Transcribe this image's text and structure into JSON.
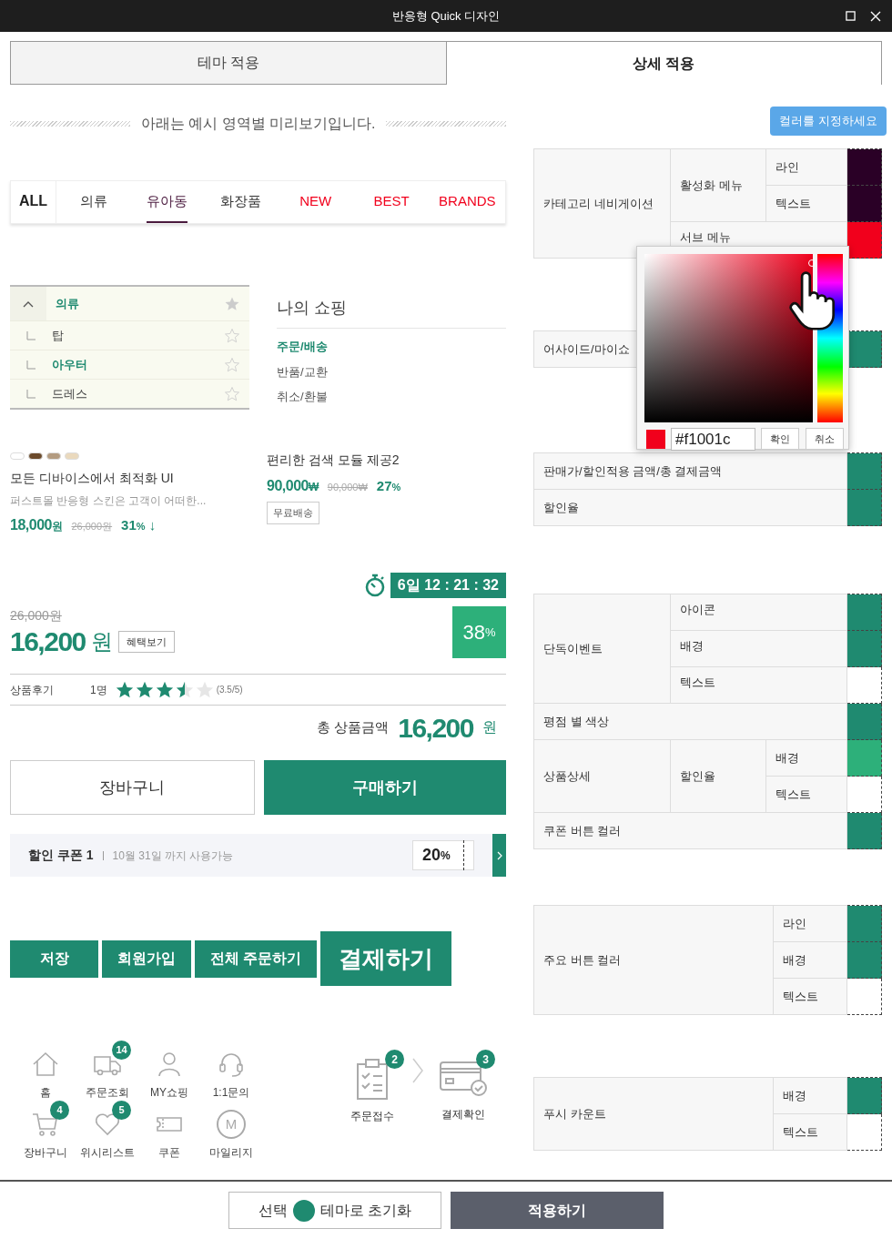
{
  "window": {
    "title": "반응형 Quick 디자인"
  },
  "tabs": [
    {
      "label": "테마 적용",
      "selected": false
    },
    {
      "label": "상세 적용",
      "selected": true
    }
  ],
  "preview": {
    "heading": "아래는 예시 영역별 미리보기입니다.",
    "category_nav": [
      {
        "label": "ALL",
        "kind": "all",
        "selected": false
      },
      {
        "label": "의류",
        "kind": "normal",
        "selected": false
      },
      {
        "label": "유아동",
        "kind": "normal",
        "selected": true
      },
      {
        "label": "화장품",
        "kind": "normal",
        "selected": false
      },
      {
        "label": "NEW",
        "kind": "accent",
        "selected": false
      },
      {
        "label": "BEST",
        "kind": "accent",
        "selected": false
      },
      {
        "label": "BRANDS",
        "kind": "accent",
        "selected": false
      }
    ],
    "side_menu": {
      "label": "의류",
      "expanded": true,
      "selected": true,
      "starred": true,
      "children": [
        {
          "label": "탑",
          "selected": false,
          "starred": false
        },
        {
          "label": "아우터",
          "selected": true,
          "starred": false
        },
        {
          "label": "드레스",
          "selected": false,
          "starred": false
        }
      ]
    },
    "my_shopping": {
      "title": "나의 쇼핑",
      "links": [
        {
          "label": "주문/배송",
          "selected": true
        },
        {
          "label": "반품/교환",
          "selected": false
        },
        {
          "label": "취소/환불",
          "selected": false
        }
      ]
    },
    "products": [
      {
        "swatches": [
          {
            "color": "#ffffff"
          },
          {
            "color": "#6b4a2b"
          },
          {
            "color": "#b39b80"
          },
          {
            "color": "#ead9bd"
          }
        ],
        "title": "모든 디바이스에서 최적화 UI",
        "description": "퍼스트몰 반응형 스킨은 고객이 어떠한...",
        "price": "18,000",
        "currency": "원",
        "old_price": "26,000원",
        "discount": "31",
        "discount_unit": "%",
        "discount_arrow": "↓"
      },
      {
        "title": "편리한 검색 모듈 제공2",
        "price": "90,000",
        "currency": "₩",
        "old_price": "90,000₩",
        "discount": "27",
        "discount_unit": "%",
        "tag": "무료배송"
      }
    ],
    "timer": {
      "day": "6일",
      "time": "12 : 21 : 32"
    },
    "deal": {
      "old_price": "26,000원",
      "price": "16,200",
      "currency": "원",
      "benefit_button": "혜택보기",
      "discount": "38",
      "discount_unit": "%"
    },
    "review": {
      "label": "상품후기",
      "count": "1명",
      "stars": 3.5,
      "score": "(3.5/5)"
    },
    "total": {
      "label": "총 상품금액",
      "amount": "16,200",
      "currency": "원"
    },
    "buy_buttons": [
      {
        "label": "장바구니",
        "kind": "outline"
      },
      {
        "label": "구매하기",
        "kind": "primary"
      }
    ],
    "coupon": {
      "title": "할인 쿠폰 1",
      "note": "10월 31일 까지 사용가능",
      "value": "20",
      "unit": "%"
    },
    "action_buttons": [
      {
        "label": "저장",
        "kind": "normal"
      },
      {
        "label": "회원가입",
        "kind": "normal"
      },
      {
        "label": "전체 주문하기",
        "kind": "normal"
      },
      {
        "label": "결제하기",
        "kind": "large"
      }
    ],
    "shortcuts": [
      {
        "label": "홈"
      },
      {
        "label": "주문조회",
        "badge": "14"
      },
      {
        "label": "MY쇼핑"
      },
      {
        "label": "1:1문의"
      },
      {
        "label": "장바구니",
        "badge": "4"
      },
      {
        "label": "위시리스트",
        "badge": "5"
      },
      {
        "label": "쿠폰"
      },
      {
        "label": "마일리지",
        "symbol": "M"
      }
    ],
    "order_steps": [
      {
        "label": "주문접수",
        "badge": "2"
      },
      {
        "label": "결제확인",
        "badge": "3"
      }
    ]
  },
  "color_tip": "컬러를 지정하세요",
  "color_groups": [
    {
      "rows": [
        {
          "label": "카테고리 네비게이션",
          "children": [
            {
              "label": "활성화 메뉴",
              "children": [
                {
                  "label": "라인",
                  "color": "#2a0026"
                },
                {
                  "label": "텍스트",
                  "color": "#2a0026"
                }
              ]
            },
            {
              "label": "서브 메뉴",
              "color": "#f1001c"
            }
          ]
        }
      ]
    },
    {
      "rows": [
        {
          "label": "어사이드/마이쇼",
          "color": "#1f8a70"
        }
      ]
    },
    {
      "rows": [
        {
          "label": "판매가/할인적용 금액/총 결제금액",
          "color": "#1f8a70"
        },
        {
          "label": "할인율",
          "color": "#1f8a70"
        }
      ]
    },
    {
      "rows": [
        {
          "label": "단독이벤트",
          "children": [
            {
              "label": "아이콘",
              "color": "#1f8a70"
            },
            {
              "label": "배경",
              "color": "#1f8a70"
            },
            {
              "label": "텍스트",
              "color": "#ffffff"
            }
          ]
        },
        {
          "label": "평점 별 색상",
          "color": "#1f8a70"
        },
        {
          "label": "상품상세",
          "children": [
            {
              "label": "할인율",
              "children": [
                {
                  "label": "배경",
                  "color": "#2db07a"
                },
                {
                  "label": "텍스트",
                  "color": "#ffffff"
                }
              ]
            }
          ]
        },
        {
          "label": "쿠폰 버튼 컬러",
          "color": "#1f8a70"
        }
      ]
    },
    {
      "rows": [
        {
          "label": "주요 버튼 컬러",
          "children": [
            {
              "label": "라인",
              "color": "#1f8a70"
            },
            {
              "label": "배경",
              "color": "#1f8a70"
            },
            {
              "label": "텍스트",
              "color": "#ffffff"
            }
          ]
        }
      ]
    },
    {
      "rows": [
        {
          "label": "푸시 카운트",
          "children": [
            {
              "label": "배경",
              "color": "#1f8a70"
            },
            {
              "label": "텍스트",
              "color": "#ffffff"
            }
          ]
        }
      ]
    }
  ],
  "color_picker": {
    "hex": "#f1001c",
    "confirm": "확인",
    "cancel": "취소"
  },
  "footer": {
    "reset_prefix": "선택",
    "reset_label": "테마로 초기화",
    "apply": "적용하기"
  }
}
